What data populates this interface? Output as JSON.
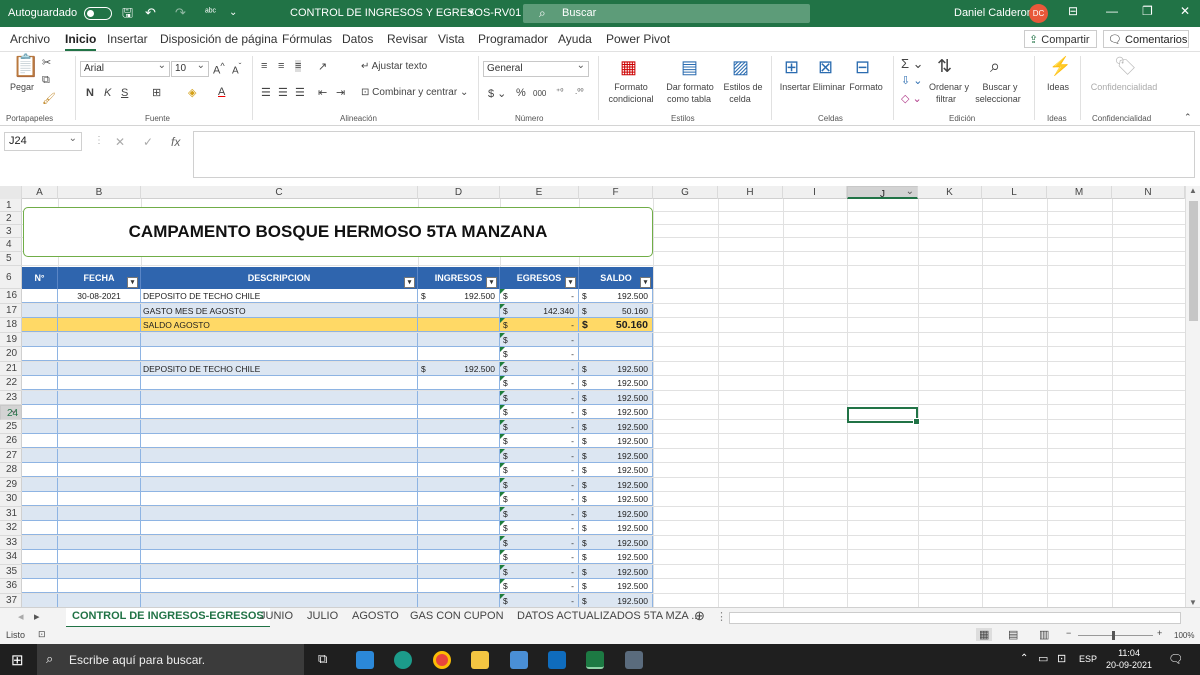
{
  "titlebar": {
    "autosave_label": "Autoguardado",
    "doc_title": "CONTROL DE INGRESOS Y EGRESOS-RV01",
    "search_placeholder": "Buscar",
    "user_name": "Daniel Calderon",
    "user_initials": "DC"
  },
  "menu": {
    "tabs": [
      "Archivo",
      "Inicio",
      "Insertar",
      "Disposición de página",
      "Fórmulas",
      "Datos",
      "Revisar",
      "Vista",
      "Programador",
      "Ayuda",
      "Power Pivot"
    ],
    "active": "Inicio",
    "share": "Compartir",
    "comments": "Comentarios"
  },
  "ribbon": {
    "paste": "Pegar",
    "group_clipboard": "Portapapeles",
    "font_name": "Arial",
    "font_size": "10",
    "bold": "N",
    "italic": "K",
    "underline": "S",
    "group_font": "Fuente",
    "wrap_text": "Ajustar texto",
    "merge_center": "Combinar y centrar",
    "group_alignment": "Alineación",
    "number_format": "General",
    "group_number": "Número",
    "cond_format_1": "Formato",
    "cond_format_2": "condicional",
    "table_format_1": "Dar formato",
    "table_format_2": "como tabla",
    "cell_styles_1": "Estilos de",
    "cell_styles_2": "celda",
    "group_styles": "Estilos",
    "insert": "Insertar",
    "delete": "Eliminar",
    "format": "Formato",
    "group_cells": "Celdas",
    "sort_1": "Ordenar y",
    "sort_2": "filtrar",
    "find_1": "Buscar y",
    "find_2": "seleccionar",
    "group_editing": "Edición",
    "ideas": "Ideas",
    "group_ideas": "Ideas",
    "sensitivity": "Confidencialidad",
    "group_sensitivity": "Confidencialidad"
  },
  "formula_bar": {
    "name_box": "J24",
    "formula": ""
  },
  "columns": [
    "A",
    "B",
    "C",
    "D",
    "E",
    "F",
    "G",
    "H",
    "I",
    "J",
    "K",
    "L",
    "M",
    "N"
  ],
  "selected_column": "J",
  "rows": [
    "1",
    "2",
    "3",
    "4",
    "5",
    "6",
    "16",
    "17",
    "18",
    "19",
    "20",
    "21",
    "22",
    "23",
    "24",
    "25",
    "26",
    "27",
    "28",
    "29",
    "30",
    "31",
    "32",
    "33",
    "34",
    "35",
    "36",
    "37"
  ],
  "selected_row": "24",
  "sheet": {
    "title": "CAMPAMENTO BOSQUE HERMOSO 5TA MANZANA",
    "headers": [
      "N°",
      "FECHA",
      "DESCRIPCION",
      "INGRESOS",
      "EGRESOS",
      "SALDO"
    ],
    "currency": "$",
    "data_rows": [
      {
        "row": "16",
        "fecha": "30-08-2021",
        "desc": "DEPOSITO DE TECHO CHILE",
        "ingreso": "192.500",
        "egreso": "-",
        "saldo": "192.500",
        "saldo_show": true
      },
      {
        "row": "17",
        "fecha": "",
        "desc": "GASTO MES DE AGOSTO",
        "ingreso": "",
        "egreso": "142.340",
        "saldo": "50.160",
        "saldo_show": true
      },
      {
        "row": "18",
        "fecha": "",
        "desc": "SALDO AGOSTO",
        "ingreso": "",
        "egreso": "-",
        "saldo": "50.160",
        "saldo_show": true,
        "highlight": true
      },
      {
        "row": "19",
        "fecha": "",
        "desc": "",
        "ingreso": "",
        "egreso": "-",
        "saldo": "",
        "saldo_show": false
      },
      {
        "row": "20",
        "fecha": "",
        "desc": "",
        "ingreso": "",
        "egreso": "-",
        "saldo": "",
        "saldo_show": false
      },
      {
        "row": "21",
        "fecha": "",
        "desc": "DEPOSITO DE TECHO CHILE",
        "ingreso": "192.500",
        "egreso": "-",
        "saldo": "192.500",
        "saldo_show": true
      },
      {
        "row": "22",
        "fecha": "",
        "desc": "",
        "ingreso": "",
        "egreso": "-",
        "saldo": "192.500",
        "saldo_show": true
      },
      {
        "row": "23",
        "fecha": "",
        "desc": "",
        "ingreso": "",
        "egreso": "-",
        "saldo": "192.500",
        "saldo_show": true
      },
      {
        "row": "24",
        "fecha": "",
        "desc": "",
        "ingreso": "",
        "egreso": "-",
        "saldo": "192.500",
        "saldo_show": true
      },
      {
        "row": "25",
        "fecha": "",
        "desc": "",
        "ingreso": "",
        "egreso": "-",
        "saldo": "192.500",
        "saldo_show": true
      },
      {
        "row": "26",
        "fecha": "",
        "desc": "",
        "ingreso": "",
        "egreso": "-",
        "saldo": "192.500",
        "saldo_show": true
      },
      {
        "row": "27",
        "fecha": "",
        "desc": "",
        "ingreso": "",
        "egreso": "-",
        "saldo": "192.500",
        "saldo_show": true
      },
      {
        "row": "28",
        "fecha": "",
        "desc": "",
        "ingreso": "",
        "egreso": "-",
        "saldo": "192.500",
        "saldo_show": true
      },
      {
        "row": "29",
        "fecha": "",
        "desc": "",
        "ingreso": "",
        "egreso": "-",
        "saldo": "192.500",
        "saldo_show": true
      },
      {
        "row": "30",
        "fecha": "",
        "desc": "",
        "ingreso": "",
        "egreso": "-",
        "saldo": "192.500",
        "saldo_show": true
      },
      {
        "row": "31",
        "fecha": "",
        "desc": "",
        "ingreso": "",
        "egreso": "-",
        "saldo": "192.500",
        "saldo_show": true
      },
      {
        "row": "32",
        "fecha": "",
        "desc": "",
        "ingreso": "",
        "egreso": "-",
        "saldo": "192.500",
        "saldo_show": true
      },
      {
        "row": "33",
        "fecha": "",
        "desc": "",
        "ingreso": "",
        "egreso": "-",
        "saldo": "192.500",
        "saldo_show": true
      },
      {
        "row": "34",
        "fecha": "",
        "desc": "",
        "ingreso": "",
        "egreso": "-",
        "saldo": "192.500",
        "saldo_show": true
      },
      {
        "row": "35",
        "fecha": "",
        "desc": "",
        "ingreso": "",
        "egreso": "-",
        "saldo": "192.500",
        "saldo_show": true
      },
      {
        "row": "36",
        "fecha": "",
        "desc": "",
        "ingreso": "",
        "egreso": "-",
        "saldo": "192.500",
        "saldo_show": true
      },
      {
        "row": "37",
        "fecha": "",
        "desc": "",
        "ingreso": "",
        "egreso": "-",
        "saldo": "192.500",
        "saldo_show": true
      }
    ]
  },
  "sheet_tabs": [
    "CONTROL DE INGRESOS-EGRESOS",
    "JUNIO",
    "JULIO",
    "AGOSTO",
    "GAS CON CUPON",
    "DATOS ACTUALIZADOS 5TA MZA ..."
  ],
  "active_sheet": "CONTROL DE INGRESOS-EGRESOS",
  "status": {
    "mode": "Listo",
    "zoom": "100%"
  },
  "taskbar": {
    "search_placeholder": "Escribe aquí para buscar.",
    "lang": "ESP",
    "time": "11:04",
    "date": "20-09-2021"
  },
  "colors": {
    "excel_green": "#217346",
    "header_blue": "#2f65ae",
    "band_blue": "#dce6f2",
    "highlight_yellow": "#ffd966",
    "title_border": "#70ad47"
  }
}
